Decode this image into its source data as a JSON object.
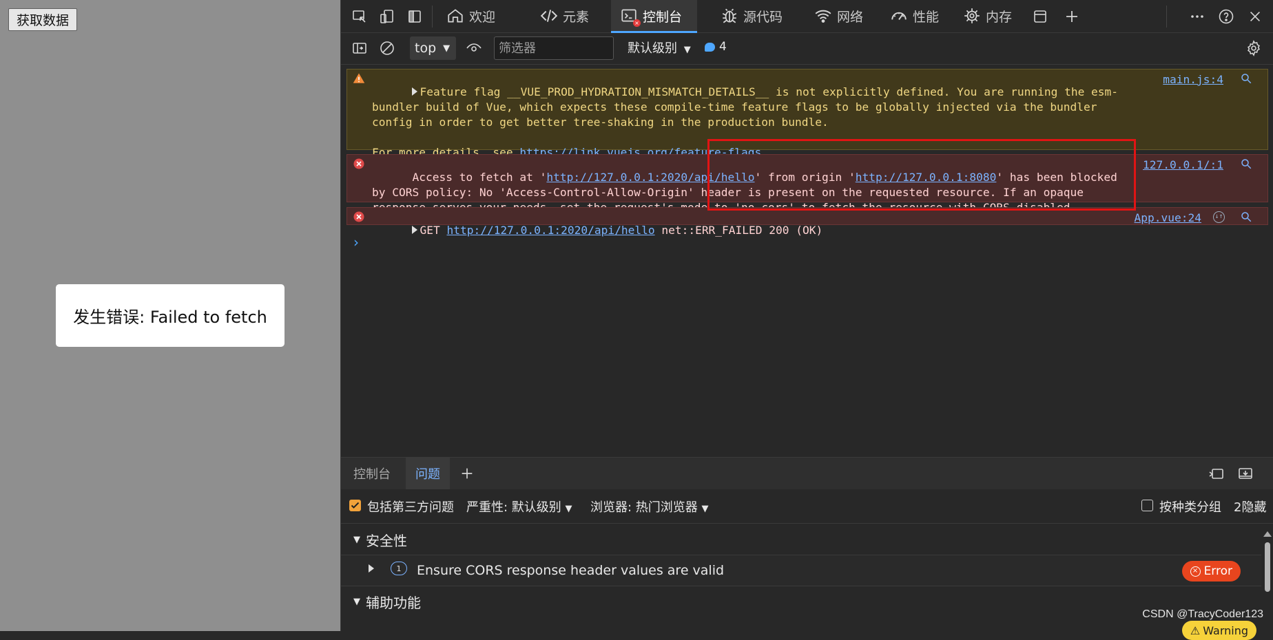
{
  "page": {
    "button_label": "获取数据",
    "error_text": "发生错误: Failed to fetch"
  },
  "devtools": {
    "tabs": [
      {
        "label": "欢迎",
        "icon": "home-icon"
      },
      {
        "label": "元素",
        "icon": "code-icon"
      },
      {
        "label": "控制台",
        "icon": "console-icon",
        "active": true
      },
      {
        "label": "源代码",
        "icon": "bug-icon"
      },
      {
        "label": "网络",
        "icon": "wifi-icon"
      },
      {
        "label": "性能",
        "icon": "gauge-icon"
      },
      {
        "label": "内存",
        "icon": "chip-icon"
      }
    ],
    "toolbar": {
      "context": "top",
      "filter_placeholder": "筛选器",
      "level": "默认级别",
      "message_count": "4"
    },
    "console": {
      "warning": {
        "text_before_link": "Feature flag __VUE_PROD_HYDRATION_MISMATCH_DETAILS__ is not explicitly defined. You are running the esm-bundler build of Vue, which expects these compile-time feature flags to be globally injected via the bundler config in order to get better tree-shaking in the production bundle.\n\nFor more details, see ",
        "link": "https://link.vuejs.org/feature-flags",
        "text_after_link": ".",
        "source": "main.js:4"
      },
      "cors_error": {
        "part1": "Access to fetch at '",
        "url1": "http://127.0.0.1:2020/api/hello",
        "part2": "' from origin '",
        "url2": "http://127.0.0.1:8080",
        "part3": "' has been blocked by CORS policy: No 'Access-Control-Allow-Origin' header is present on the requested resource. If an opaque response serves your needs, set the request's mode to 'no-cors' to fetch the resource with CORS disabled.",
        "source": "127.0.0.1/:1"
      },
      "get_error": {
        "method": "GET ",
        "url": "http://127.0.0.1:2020/api/hello",
        "status": " net::ERR_FAILED 200 (OK)",
        "source": "App.vue:24"
      }
    },
    "drawer": {
      "tabs": [
        "控制台",
        "问题"
      ],
      "active_tab": "问题",
      "include_third_party": "包括第三方问题",
      "severity": "严重性: 默认级别",
      "browser": "浏览器:  热门浏览器",
      "group_by_kind": "按种类分组",
      "hidden": "2隐藏",
      "sections": {
        "security": "安全性",
        "accessibility": "辅助功能"
      },
      "issue": {
        "count": "1",
        "text": "Ensure CORS response header values are valid",
        "level": "Error"
      }
    }
  },
  "watermark": "CSDN @TracyCoder123",
  "warning_pill": "Warning",
  "colors": {
    "accent": "#4ea7ff",
    "error": "#e8451e",
    "highlight_box": "#e11414"
  }
}
